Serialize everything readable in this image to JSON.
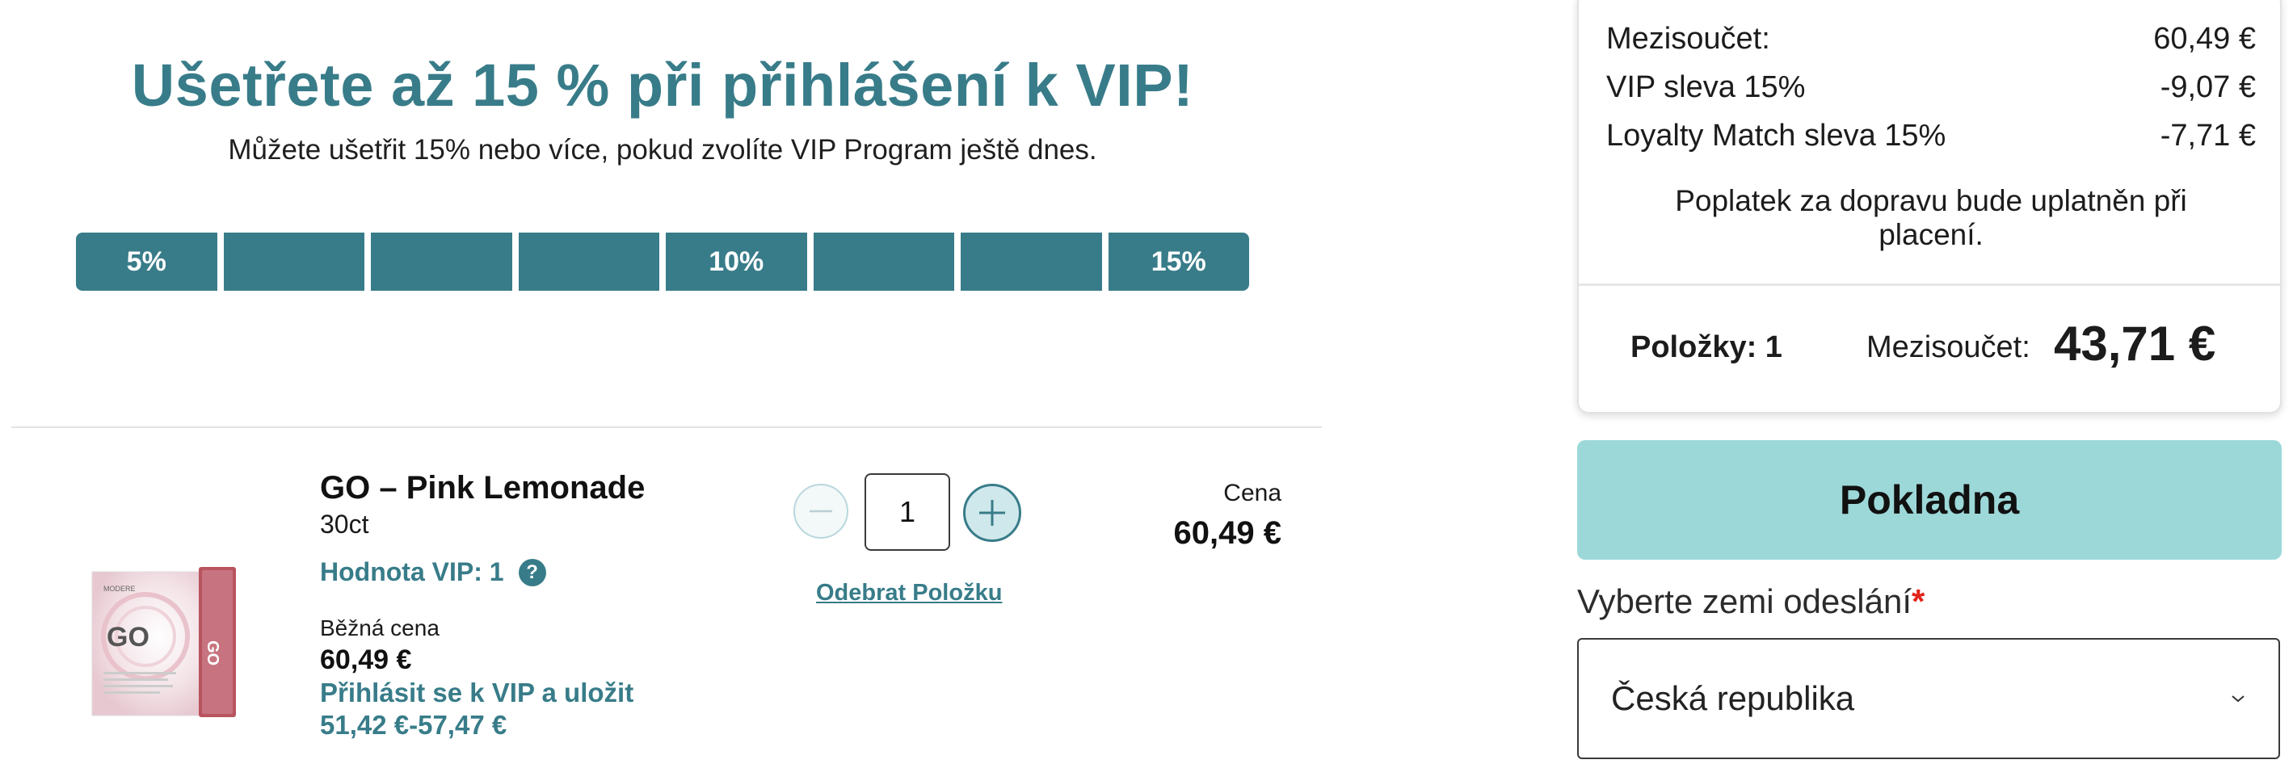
{
  "vip_promo": {
    "heading": "Ušetřete až 15 % při přihlášení k VIP!",
    "subheading": "Můžete ušetřit 15% nebo více, pokud zvolíte VIP Program ještě dnes.",
    "progress_segments": [
      "5%",
      "",
      "",
      "",
      "10%",
      "",
      "",
      "15%"
    ]
  },
  "cart_item": {
    "image_brand_text": "MODERE",
    "image_product_text": "GO",
    "name": "GO – Pink Lemonade",
    "size": "30ct",
    "vip_value_label": "Hodnota VIP: 1",
    "help_icon": "question-icon",
    "regular_price_label": "Běžná cena",
    "regular_price": "60,49 €",
    "vip_join_label": "Přihlásit se k VIP a uložit",
    "vip_price_range": "51,42 €-57,47 €",
    "quantity": "1",
    "remove_label": "Odebrat Položku",
    "price_label": "Cena",
    "price": "60,49 €"
  },
  "summary": {
    "rows": [
      {
        "label": "Mezisoučet:",
        "value": "60,49 €"
      },
      {
        "label": "VIP sleva 15%",
        "value": "-9,07 €"
      },
      {
        "label": "Loyalty Match sleva 15%",
        "value": "-7,71 €"
      }
    ],
    "shipping_note": "Poplatek za dopravu bude uplatněn při placení.",
    "items_count": "Položky: 1",
    "total_label": "Mezisoučet:",
    "total_value": "43,71 €"
  },
  "checkout": {
    "button_label": "Pokladna",
    "country_label": "Vyberte zemi odeslání",
    "required_mark": "*",
    "country_value": "Česká republika"
  },
  "colors": {
    "accent": "#387c89",
    "checkout_button": "#9dd8d9",
    "required": "#e2231a"
  }
}
